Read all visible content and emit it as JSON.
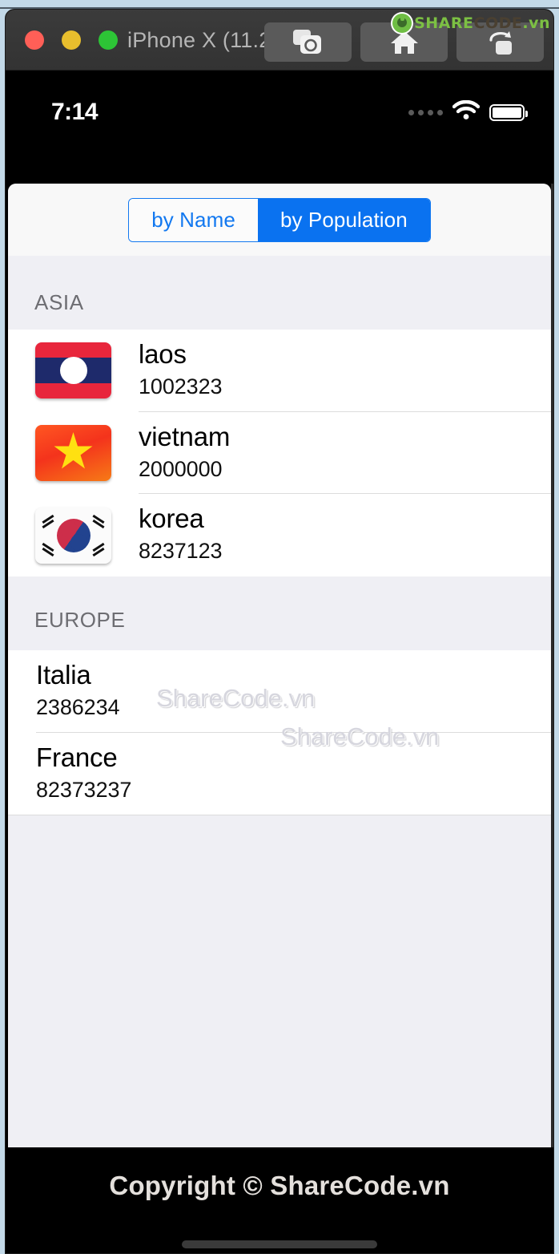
{
  "simulator": {
    "title": "iPhone X (11.2)",
    "traffic_lights": [
      "close",
      "minimize",
      "zoom"
    ],
    "toolbar_buttons": [
      {
        "name": "screenshot",
        "icon": "camera-icon"
      },
      {
        "name": "home",
        "icon": "home-icon"
      },
      {
        "name": "rotate",
        "icon": "rotate-share-icon"
      }
    ],
    "logo": {
      "share": "SHARE",
      "code": "CODE",
      "vn": ".vn"
    }
  },
  "status_bar": {
    "time": "7:14",
    "signal_icon": "signal-dots-icon",
    "wifi_icon": "wifi-icon",
    "battery_icon": "battery-full-icon"
  },
  "segmented_control": {
    "options": [
      {
        "label": "by Name",
        "selected": false
      },
      {
        "label": "by Population",
        "selected": true
      }
    ],
    "accent_color": "#0A72F0",
    "border_color": "#1278F0"
  },
  "sections": [
    {
      "header": "ASIA",
      "rows": [
        {
          "name": "laos",
          "population": "1002323",
          "flag": "laos-flag"
        },
        {
          "name": "vietnam",
          "population": "2000000",
          "flag": "vietnam-flag"
        },
        {
          "name": "korea",
          "population": "8237123",
          "flag": "korea-flag"
        }
      ]
    },
    {
      "header": "EUROPE",
      "rows": [
        {
          "name": "Italia",
          "population": "2386234",
          "flag": null
        },
        {
          "name": "France",
          "population": "82373237",
          "flag": null
        }
      ]
    }
  ],
  "watermarks": [
    "ShareCode.vn",
    "ShareCode.vn"
  ],
  "footer": {
    "copyright": "Copyright © ShareCode.vn"
  },
  "colors": {
    "list_background": "#EFEFF4",
    "row_background": "#FFFFFF",
    "separator": "#DCDCDC",
    "section_header_text": "#6D6D72",
    "watermark": "#D6D6DE"
  }
}
